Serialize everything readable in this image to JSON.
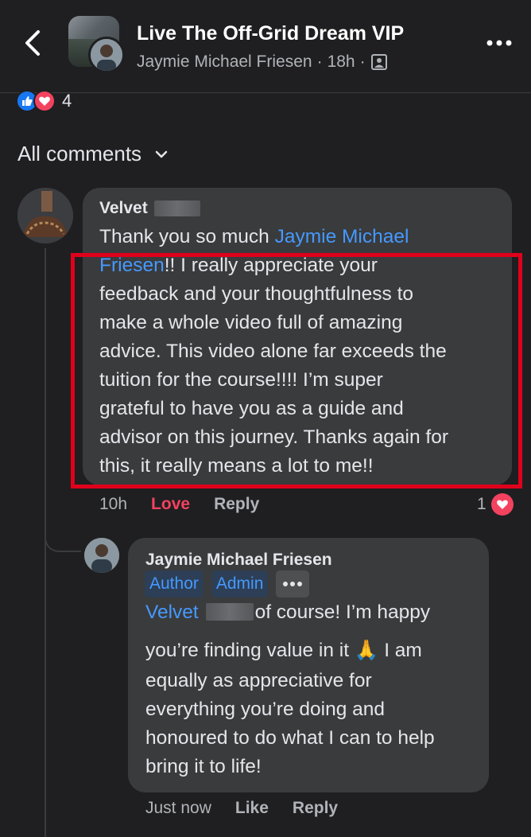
{
  "header": {
    "title": "Live The Off-Grid Dream VIP",
    "author": "Jaymie Michael Friesen",
    "time": "18h",
    "separator": "·",
    "audience_icon": "photo-group-icon"
  },
  "post_reactions": {
    "count": "4",
    "icons": [
      "like-icon",
      "love-icon"
    ]
  },
  "comments_filter": {
    "label": "All comments",
    "icon": "chevron-down-icon"
  },
  "comment": {
    "author_first": "Velvet",
    "mention": "Jaymie Michael Friesen",
    "text_lines": [
      {
        "pre": "Thank you so much ",
        "mention": "Jaymie Michael",
        "post": ""
      },
      {
        "pre": "",
        "mention": "Friesen",
        "post": "!! I really appreciate your"
      },
      {
        "pre": "feedback and your thoughtfulness to",
        "mention": "",
        "post": ""
      },
      {
        "pre": "make a whole video full of amazing",
        "mention": "",
        "post": ""
      },
      {
        "pre": "advice. This video alone far exceeds  the",
        "mention": "",
        "post": ""
      },
      {
        "pre": "tuition for the course!!!! I’m super",
        "mention": "",
        "post": ""
      },
      {
        "pre": "grateful to have you as a guide and",
        "mention": "",
        "post": ""
      },
      {
        "pre": "advisor on this journey. Thanks again for",
        "mention": "",
        "post": ""
      },
      {
        "pre": "this, it really means a lot to me!!",
        "mention": "",
        "post": ""
      }
    ],
    "time": "10h",
    "love_label": "Love",
    "reply_label": "Reply",
    "reaction_count": "1",
    "highlight_color": "#e0001b"
  },
  "reply": {
    "author": "Jaymie Michael Friesen",
    "badges": [
      "Author",
      "Admin"
    ],
    "mention": "Velvet",
    "lines": [
      "of course! I’m happy",
      "you’re finding value in it",
      "I am",
      "equally as appreciative for",
      "everything you’re doing and",
      "honoured to do what I can to help",
      "bring it to life!"
    ],
    "emoji": "🙏",
    "time": "Just now",
    "like_label": "Like",
    "reply_label": "Reply"
  },
  "colors": {
    "background": "#1f1f21",
    "bubble": "#3a3b3c",
    "mention": "#4599ff",
    "love": "#f3425f",
    "like": "#1877f2"
  }
}
